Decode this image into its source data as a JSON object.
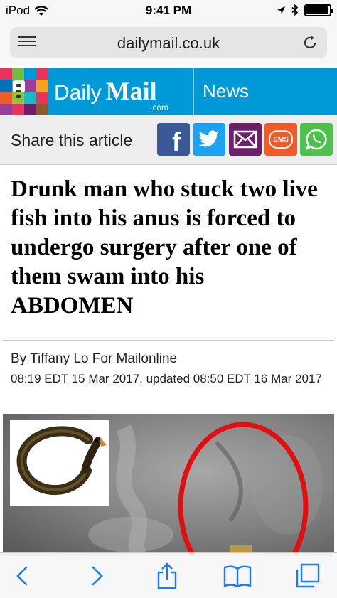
{
  "status_bar": {
    "device": "iPod",
    "time": "9:41 PM",
    "battery_level": 0.95
  },
  "browser": {
    "url": "dailymail.co.uk"
  },
  "site_header": {
    "logo_daily": "Daily",
    "logo_mail": "Mail",
    "logo_com": ".com",
    "section": "News",
    "colors": {
      "bar": "#0099d8"
    }
  },
  "share": {
    "label": "Share this article",
    "buttons": [
      {
        "name": "facebook",
        "glyph": "f",
        "color": "#3b5998"
      },
      {
        "name": "twitter",
        "glyph": "",
        "color": "#1da1f2"
      },
      {
        "name": "email",
        "glyph": "",
        "color": "#6d1f6a"
      },
      {
        "name": "sms",
        "glyph": "SMS",
        "color": "#f15a29"
      },
      {
        "name": "whatsapp",
        "glyph": "",
        "color": "#4cc24a"
      }
    ]
  },
  "article": {
    "headline": "Drunk man who stuck two live fish into his anus is forced to undergo surgery after one of them swam into his ABDOMEN",
    "byline": "By Tiffany Lo For Mailonline",
    "dateline": "08:19 EDT 15 Mar 2017, updated 08:50 EDT 16 Mar 2017"
  }
}
